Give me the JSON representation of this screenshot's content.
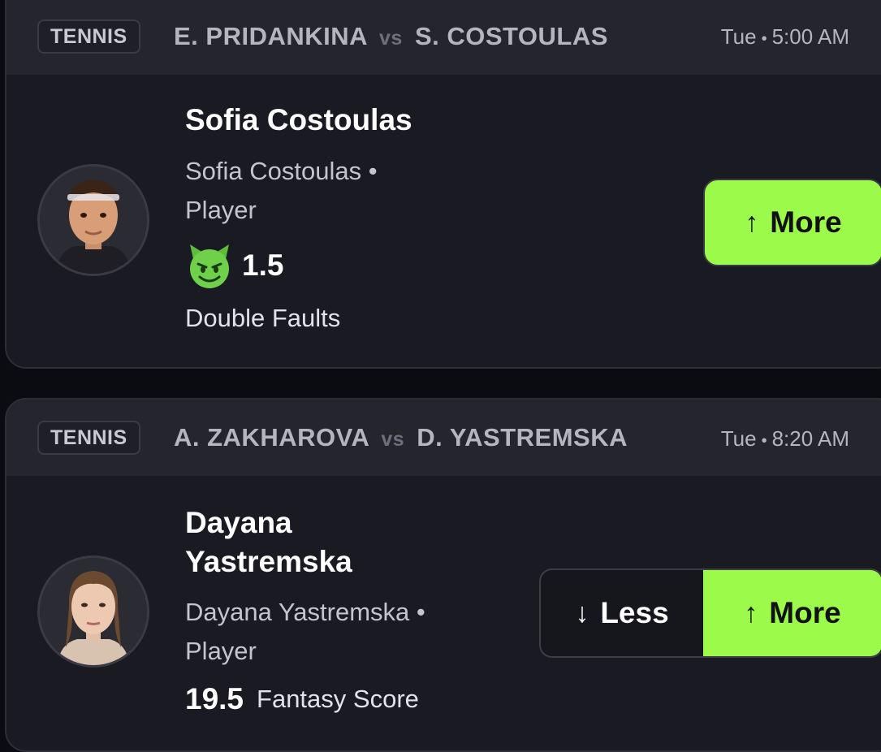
{
  "cards": [
    {
      "sport": "TENNIS",
      "player1": "E. PRIDANKINA",
      "vs": "vs",
      "player2": "S. COSTOULAS",
      "day": "Tue",
      "time": "5:00 AM",
      "player_name": "Sofia Costoulas",
      "player_sub": "Sofia Costoulas • Player",
      "line_value": "1.5",
      "stat": "Double Faults",
      "icon": "demon-icon",
      "more_label": "More"
    },
    {
      "sport": "TENNIS",
      "player1": "A. ZAKHAROVA",
      "vs": "vs",
      "player2": "D. YASTREMSKA",
      "day": "Tue",
      "time": "8:20 AM",
      "player_name": "Dayana Yastremska",
      "player_sub": "Dayana Yastremska • Player",
      "line_value": "19.5",
      "stat": "Fantasy Score",
      "less_label": "Less",
      "more_label": "More"
    }
  ],
  "colors": {
    "accent": "#9cfb4a",
    "card_bg": "#1a1a22",
    "header_bg": "#25252e",
    "page_bg": "#0b0b12"
  }
}
